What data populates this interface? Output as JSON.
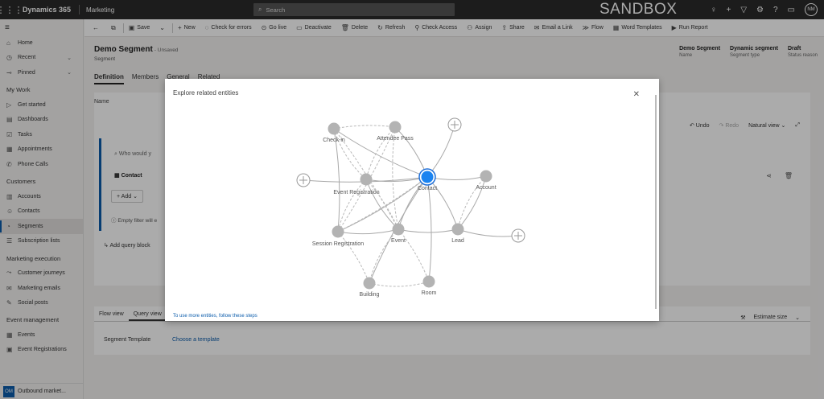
{
  "topbar": {
    "brand": "Dynamics 365",
    "app": "Marketing",
    "search_placeholder": "Search",
    "env_label": "SANDBOX",
    "user_initials": "NM"
  },
  "sidebar": {
    "items_top": [
      {
        "label": "Home",
        "icon": "home-icon"
      },
      {
        "label": "Recent",
        "icon": "clock-icon",
        "chevron": true
      },
      {
        "label": "Pinned",
        "icon": "pin-icon",
        "chevron": true
      }
    ],
    "sections": [
      {
        "header": "My Work",
        "items": [
          {
            "label": "Get started",
            "icon": "play-icon"
          },
          {
            "label": "Dashboards",
            "icon": "dashboard-icon"
          },
          {
            "label": "Tasks",
            "icon": "task-icon"
          },
          {
            "label": "Appointments",
            "icon": "calendar-icon"
          },
          {
            "label": "Phone Calls",
            "icon": "phone-icon"
          }
        ]
      },
      {
        "header": "Customers",
        "items": [
          {
            "label": "Accounts",
            "icon": "building-icon"
          },
          {
            "label": "Contacts",
            "icon": "person-icon"
          },
          {
            "label": "Segments",
            "icon": "segment-icon",
            "active": true
          },
          {
            "label": "Subscription lists",
            "icon": "list-icon"
          }
        ]
      },
      {
        "header": "Marketing execution",
        "items": [
          {
            "label": "Customer journeys",
            "icon": "journey-icon"
          },
          {
            "label": "Marketing emails",
            "icon": "email-icon"
          },
          {
            "label": "Social posts",
            "icon": "social-icon"
          }
        ]
      },
      {
        "header": "Event management",
        "items": [
          {
            "label": "Events",
            "icon": "event-icon"
          },
          {
            "label": "Event Registrations",
            "icon": "registration-icon"
          }
        ]
      }
    ],
    "area": {
      "badge": "OM",
      "label": "Outbound market..."
    }
  },
  "commands": [
    {
      "label": "",
      "icon": "back-icon"
    },
    {
      "label": "",
      "icon": "popout-icon"
    },
    {
      "label": "Save",
      "icon": "save-icon"
    },
    {
      "label": "",
      "icon": "chevron-down-icon"
    },
    {
      "label": "New",
      "icon": "plus-icon"
    },
    {
      "label": "Check for errors",
      "icon": "check-errors-icon"
    },
    {
      "label": "Go live",
      "icon": "go-live-icon"
    },
    {
      "label": "Deactivate",
      "icon": "deactivate-icon"
    },
    {
      "label": "Delete",
      "icon": "trash-icon"
    },
    {
      "label": "Refresh",
      "icon": "refresh-icon"
    },
    {
      "label": "Check Access",
      "icon": "check-access-icon"
    },
    {
      "label": "Assign",
      "icon": "assign-icon"
    },
    {
      "label": "Share",
      "icon": "share-icon"
    },
    {
      "label": "Email a Link",
      "icon": "email-link-icon"
    },
    {
      "label": "Flow",
      "icon": "flow-icon"
    },
    {
      "label": "Word Templates",
      "icon": "word-templates-icon"
    },
    {
      "label": "Run Report",
      "icon": "report-icon"
    }
  ],
  "record": {
    "title": "Demo Segment",
    "status": "- Unsaved",
    "entity": "Segment",
    "header_fields": [
      {
        "value": "Demo Segment",
        "label": "Name"
      },
      {
        "value": "Dynamic segment",
        "label": "Segment type"
      },
      {
        "value": "Draft",
        "label": "Status reason"
      }
    ],
    "tabs": [
      "Definition",
      "Members",
      "General",
      "Related"
    ]
  },
  "designer": {
    "name_label": "Name",
    "undo": "Undo",
    "redo": "Redo",
    "view": "Natural view",
    "search_placeholder": "Who would y",
    "entity": "Contact",
    "add": "Add",
    "hint": "Empty filter will e",
    "add_query_block": "Add query block",
    "bottom_tabs": [
      "Flow view",
      "Query view"
    ],
    "estimate": "Estimate size",
    "template_label": "Segment Template",
    "template_link": "Choose a template"
  },
  "modal": {
    "title": "Explore related entities",
    "footer_link": "To use more entities, follow these steps",
    "nodes": [
      {
        "id": "checkin",
        "label": "Check-in",
        "kind": "entity"
      },
      {
        "id": "attendee",
        "label": "Attendee Pass",
        "kind": "entity"
      },
      {
        "id": "eventreg",
        "label": "Event Registration",
        "kind": "entity"
      },
      {
        "id": "contact",
        "label": "Contact",
        "kind": "selected"
      },
      {
        "id": "account",
        "label": "Account",
        "kind": "entity"
      },
      {
        "id": "session",
        "label": "Session Registration",
        "kind": "entity"
      },
      {
        "id": "event",
        "label": "Event",
        "kind": "entity"
      },
      {
        "id": "lead",
        "label": "Lead",
        "kind": "entity"
      },
      {
        "id": "building",
        "label": "Building",
        "kind": "entity"
      },
      {
        "id": "room",
        "label": "Room",
        "kind": "entity"
      },
      {
        "id": "add1",
        "label": "",
        "kind": "add"
      },
      {
        "id": "add2",
        "label": "",
        "kind": "add"
      },
      {
        "id": "add3",
        "label": "",
        "kind": "add"
      }
    ]
  }
}
